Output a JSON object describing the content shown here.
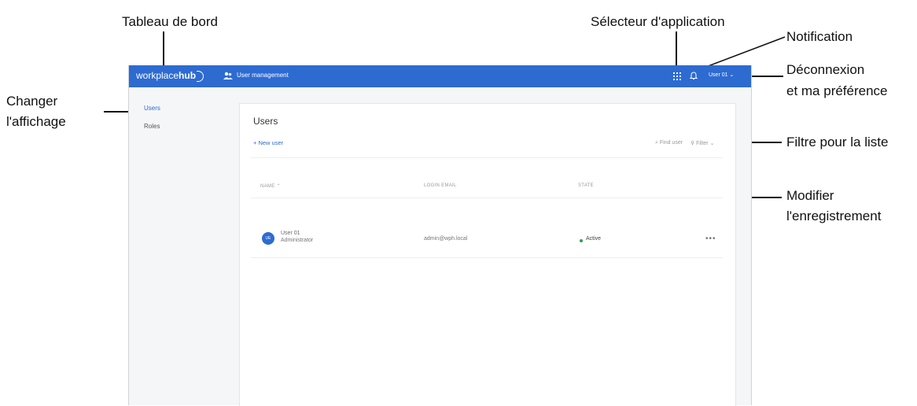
{
  "callouts": {
    "dashboard": "Tableau de bord",
    "app_selector": "Sélecteur d'application",
    "notification": "Notification",
    "logout_line1": "Déconnexion",
    "logout_line2": "et ma préférence",
    "view_line1": "Changer",
    "view_line2": "l'affichage",
    "filter_list": "Filtre pour la liste",
    "edit_line1": "Modifier",
    "edit_line2": "l'enregistrement"
  },
  "topbar": {
    "logo_text": "workplace",
    "logo_bold": "hub",
    "app_title": "User management",
    "user_menu": "User 01 ⌄",
    "bar_color": "#2d6bd1"
  },
  "sidebar": {
    "items": [
      {
        "label": "Users"
      },
      {
        "label": "Roles"
      }
    ]
  },
  "main": {
    "title": "Users",
    "new_user": "+ New user",
    "find_user": "⌕  Find user",
    "filter": "⊽ Filter ⌄",
    "columns": [
      "NAME ⌃",
      "LOGIN EMAIL",
      "STATE"
    ],
    "rows": [
      {
        "avatar": "UE",
        "name": "User 01",
        "role": "Administrator",
        "email": "admin@wph.local",
        "state": "Active",
        "more": "•••"
      }
    ]
  }
}
